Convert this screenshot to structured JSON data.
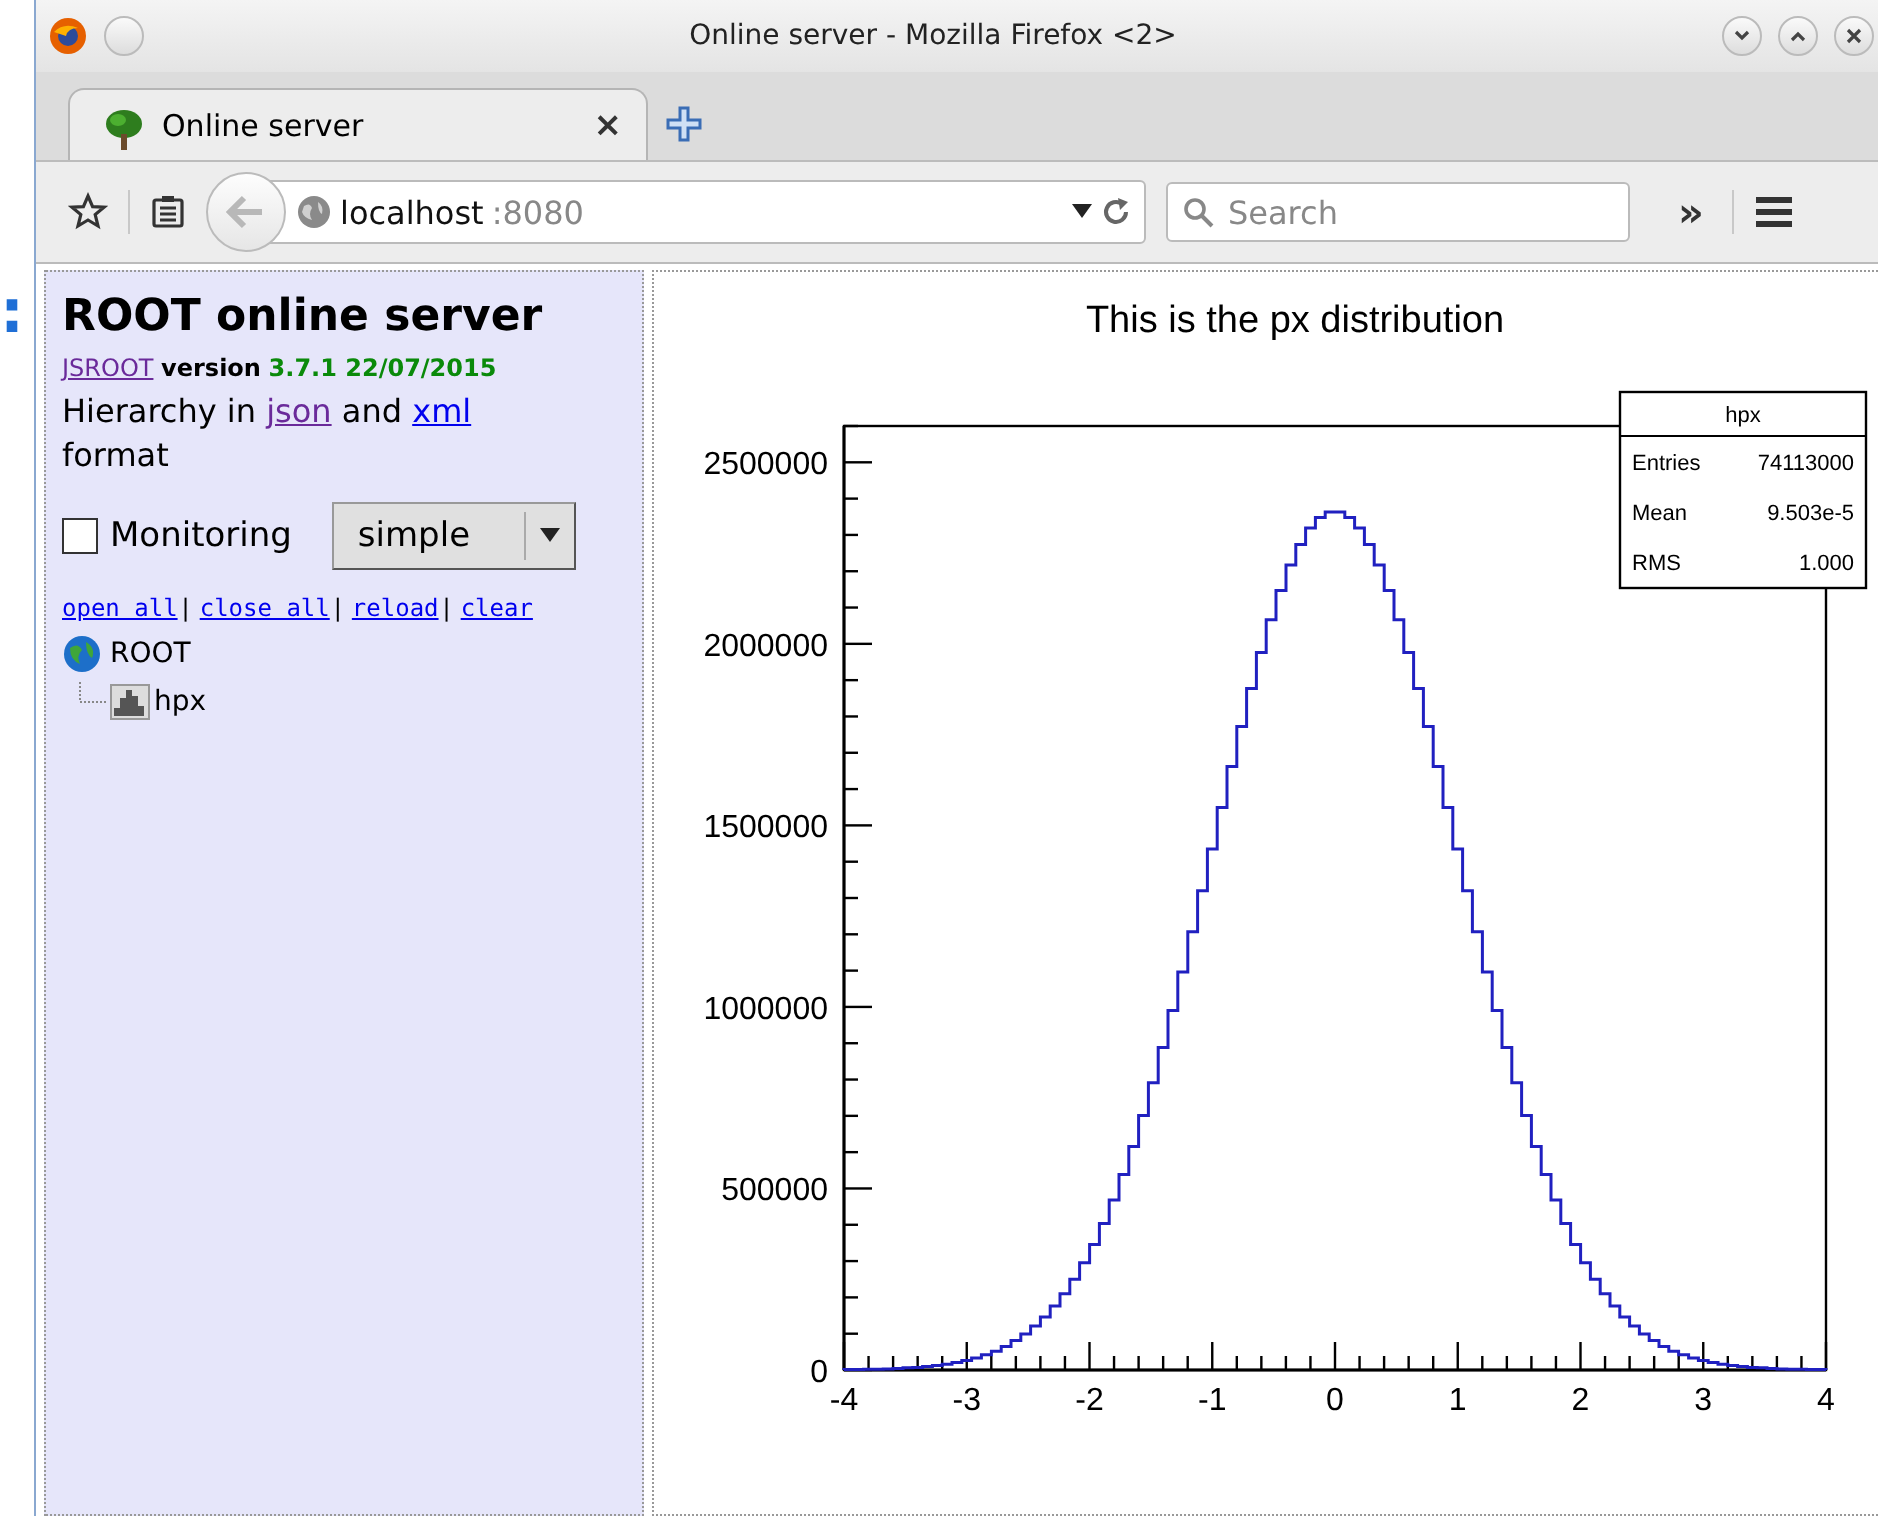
{
  "desktop_fragment": ":",
  "window": {
    "title": "Online server - Mozilla Firefox <2>"
  },
  "tabs": [
    {
      "label": "Online server",
      "close": "×",
      "selected": true
    }
  ],
  "toolbar": {
    "url": {
      "host": "localhost",
      "port": ":8080"
    },
    "search": {
      "placeholder": "Search"
    },
    "overflow": "»"
  },
  "sidebar": {
    "title": "ROOT online server",
    "version": {
      "link": "JSROOT",
      "word": "version",
      "number": "3.7.1 22/07/2015"
    },
    "hierarchy": {
      "before": "Hierarchy in ",
      "link1": "json",
      "middle": " and ",
      "link2": "xml",
      "after": " format"
    },
    "monitoring": {
      "label": "Monitoring",
      "checked": false
    },
    "mode_select": {
      "value": "simple"
    },
    "links": [
      {
        "label": "open all",
        "separator": "|"
      },
      {
        "label": "close all",
        "separator": "|"
      },
      {
        "label": "reload",
        "separator": "|"
      },
      {
        "label": "clear"
      }
    ],
    "tree": [
      {
        "label": "ROOT",
        "kind": "folder",
        "expanded": true,
        "children": [
          {
            "label": "hpx",
            "kind": "histogram"
          }
        ]
      }
    ]
  },
  "plot": {
    "stats": {
      "title": "hpx",
      "rows": [
        {
          "name": "Entries",
          "value": "74113000"
        },
        {
          "name": "Mean",
          "value": "9.503e-5"
        },
        {
          "name": "RMS",
          "value": "1.000"
        }
      ]
    },
    "chart_data": {
      "type": "line",
      "title": "This is the px distribution",
      "xlim": [
        -4,
        4
      ],
      "ylim": [
        0,
        2600000
      ],
      "xticks": [
        -4,
        -3,
        -2,
        -1,
        0,
        1,
        2,
        3,
        4
      ],
      "yticks": [
        0,
        500000,
        1000000,
        1500000,
        2000000,
        2500000
      ],
      "x": [
        -3.96,
        -3.88,
        -3.8,
        -3.72,
        -3.64,
        -3.56,
        -3.48,
        -3.4,
        -3.32,
        -3.24,
        -3.16,
        -3.08,
        -3.0,
        -2.92,
        -2.84,
        -2.76,
        -2.68,
        -2.6,
        -2.52,
        -2.44,
        -2.36,
        -2.28,
        -2.2,
        -2.12,
        -2.04,
        -1.96,
        -1.88,
        -1.8,
        -1.72,
        -1.64,
        -1.56,
        -1.48,
        -1.4,
        -1.32,
        -1.24,
        -1.16,
        -1.08,
        -1.0,
        -0.92,
        -0.84,
        -0.76,
        -0.68,
        -0.6,
        -0.52,
        -0.44,
        -0.36,
        -0.28,
        -0.2,
        -0.12,
        -0.04,
        0.04,
        0.12,
        0.2,
        0.28,
        0.36,
        0.44,
        0.52,
        0.6,
        0.68,
        0.76,
        0.84,
        0.92,
        1.0,
        1.08,
        1.16,
        1.24,
        1.32,
        1.4,
        1.48,
        1.56,
        1.64,
        1.72,
        1.8,
        1.88,
        1.96,
        2.04,
        2.12,
        2.2,
        2.28,
        2.36,
        2.44,
        2.52,
        2.6,
        2.68,
        2.76,
        2.84,
        2.92,
        3.0,
        3.08,
        3.16,
        3.24,
        3.32,
        3.4,
        3.48,
        3.56,
        3.64,
        3.72,
        3.8,
        3.88,
        3.96
      ],
      "series": [
        {
          "color": "#2020c0",
          "values": [
            1000,
            1000,
            2000,
            2000,
            3000,
            4000,
            6000,
            7000,
            10000,
            12000,
            16000,
            21000,
            26000,
            33000,
            42000,
            52000,
            65000,
            81000,
            99000,
            121000,
            146000,
            176000,
            210000,
            250000,
            295000,
            346000,
            404000,
            468000,
            539000,
            616000,
            701000,
            791000,
            888000,
            990000,
            1096000,
            1207000,
            1320000,
            1435000,
            1549000,
            1662000,
            1772000,
            1877000,
            1976000,
            2066000,
            2147000,
            2217000,
            2274000,
            2319000,
            2348000,
            2363000,
            2363000,
            2348000,
            2319000,
            2274000,
            2217000,
            2147000,
            2066000,
            1976000,
            1877000,
            1772000,
            1662000,
            1549000,
            1435000,
            1320000,
            1207000,
            1096000,
            990000,
            888000,
            791000,
            701000,
            616000,
            539000,
            468000,
            404000,
            346000,
            295000,
            250000,
            210000,
            176000,
            146000,
            121000,
            99000,
            81000,
            65000,
            52000,
            42000,
            33000,
            26000,
            21000,
            16000,
            12000,
            10000,
            7000,
            6000,
            4000,
            3000,
            2000,
            2000,
            1000,
            1000
          ]
        }
      ]
    }
  }
}
